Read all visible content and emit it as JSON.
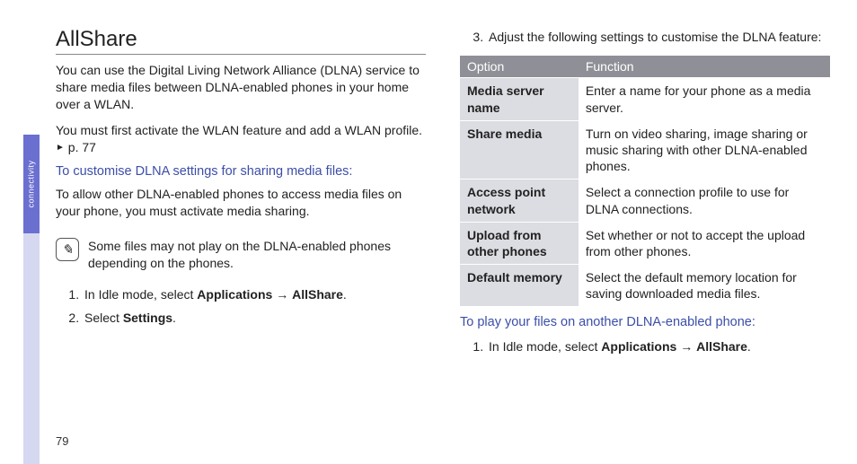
{
  "sidebar": {
    "label": "connectivity"
  },
  "page_number": "79",
  "left": {
    "heading": "AllShare",
    "p1": "You can use the Digital Living Network Alliance (DLNA) service to share media files between DLNA-enabled phones in your home over a WLAN.",
    "p2a": "You must first activate the WLAN feature and add a WLAN profile. ",
    "p2_ref": "►",
    "p2b": " p. 77",
    "sub1": "To customise DLNA settings for sharing media files:",
    "p3": "To allow other DLNA-enabled phones to access media files on your phone, you must activate media sharing.",
    "note_icon": "✎",
    "note": "Some files may not play on the DLNA-enabled phones depending on the phones.",
    "step1_a": "In Idle mode, select ",
    "step1_b": "Applications",
    "step1_c": " → ",
    "step1_d": "AllShare",
    "step1_e": ".",
    "step2_a": "Select ",
    "step2_b": "Settings",
    "step2_c": "."
  },
  "right": {
    "step3": "Adjust the following settings to customise the DLNA feature:",
    "th_option": "Option",
    "th_function": "Function",
    "rows": [
      {
        "opt": "Media server name",
        "fn": "Enter a name for your phone as a media server."
      },
      {
        "opt": "Share media",
        "fn": "Turn on video sharing, image sharing or music sharing with other DLNA-enabled phones."
      },
      {
        "opt": "Access point network",
        "fn": "Select a connection profile to use for DLNA connections."
      },
      {
        "opt": "Upload from other phones",
        "fn": "Set whether or not to accept the upload from other phones."
      },
      {
        "opt": "Default memory",
        "fn": "Select the default memory location for saving downloaded media files."
      }
    ],
    "sub2": "To play your files on another DLNA-enabled phone:",
    "step1b_a": "In Idle mode, select ",
    "step1b_b": "Applications",
    "step1b_c": " → ",
    "step1b_d": "AllShare",
    "step1b_e": "."
  }
}
